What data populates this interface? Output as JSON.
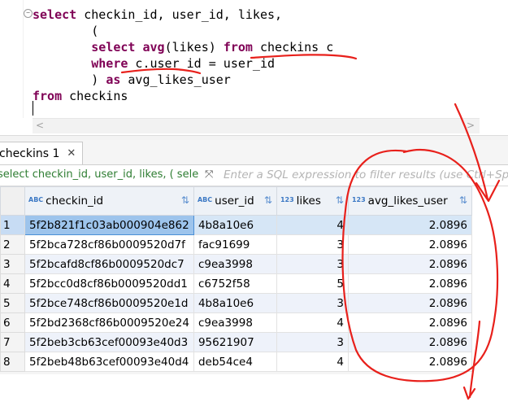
{
  "editor": {
    "lines": [
      "select checkin_id, user_id, likes,",
      "(",
      "select avg(likes) from checkins c",
      "where c.user_id = user_id",
      ") as avg_likes_user",
      "from checkins"
    ]
  },
  "result_tab": {
    "label": "checkins 1"
  },
  "filter": {
    "query": "select checkin_id, user_id, likes, ( sele",
    "placeholder": "Enter a SQL expression to filter results (use Ctrl+Space)"
  },
  "grid": {
    "columns": [
      {
        "type_icon": "ABC",
        "label": "checkin_id"
      },
      {
        "type_icon": "ABC",
        "label": "user_id"
      },
      {
        "type_icon": "123",
        "label": "likes"
      },
      {
        "type_icon": "123",
        "label": "avg_likes_user"
      }
    ],
    "rows": [
      {
        "n": "1",
        "checkin_id": "5f2b821f1c03ab000904e862",
        "user_id": "4b8a10e6",
        "likes": "4",
        "avg_likes_user": "2.0896"
      },
      {
        "n": "2",
        "checkin_id": "5f2bca728cf86b0009520d7f",
        "user_id": "fac91699",
        "likes": "3",
        "avg_likes_user": "2.0896"
      },
      {
        "n": "3",
        "checkin_id": "5f2bcafd8cf86b0009520dc7",
        "user_id": "c9ea3998",
        "likes": "3",
        "avg_likes_user": "2.0896"
      },
      {
        "n": "4",
        "checkin_id": "5f2bcc0d8cf86b0009520dd1",
        "user_id": "c6752f58",
        "likes": "5",
        "avg_likes_user": "2.0896"
      },
      {
        "n": "5",
        "checkin_id": "5f2bce748cf86b0009520e1d",
        "user_id": "4b8a10e6",
        "likes": "3",
        "avg_likes_user": "2.0896"
      },
      {
        "n": "6",
        "checkin_id": "5f2bd2368cf86b0009520e24",
        "user_id": "c9ea3998",
        "likes": "4",
        "avg_likes_user": "2.0896"
      },
      {
        "n": "7",
        "checkin_id": "5f2beb3cb63cef00093e40d3",
        "user_id": "95621907",
        "likes": "3",
        "avg_likes_user": "2.0896"
      },
      {
        "n": "8",
        "checkin_id": "5f2beb48b63cef00093e40d4",
        "user_id": "deb54ce4",
        "likes": "4",
        "avg_likes_user": "2.0896"
      }
    ]
  },
  "colors": {
    "keyword": "#7f0055",
    "annotation": "#e8201b",
    "selection": "#d6e6f6"
  }
}
